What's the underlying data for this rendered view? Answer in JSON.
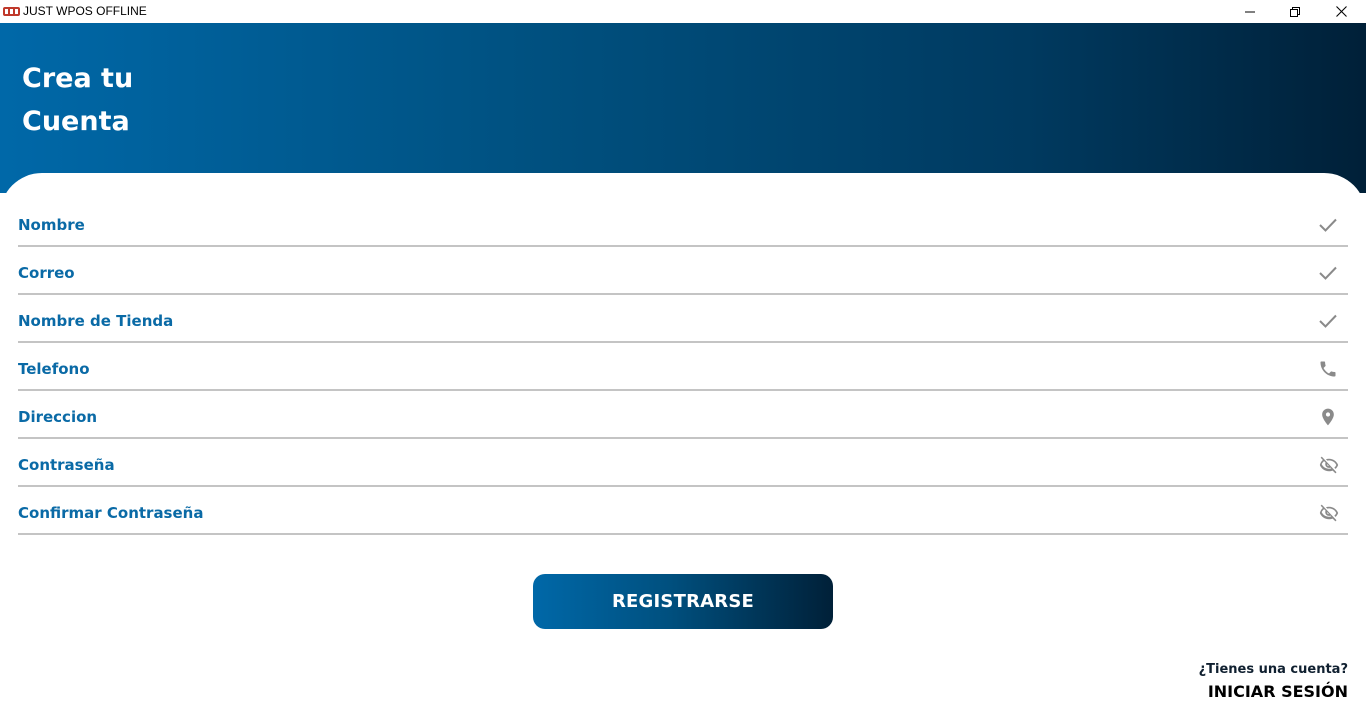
{
  "window": {
    "title": "JUST WPOS OFFLINE",
    "icons": [
      "app-logo-icon",
      "minimize-icon",
      "restore-icon",
      "close-icon"
    ]
  },
  "header": {
    "title_line1": "Crea tu",
    "title_line2": "Cuenta"
  },
  "form": {
    "fields": [
      {
        "label": "Nombre",
        "icon": "check-icon"
      },
      {
        "label": "Correo",
        "icon": "check-icon"
      },
      {
        "label": "Nombre de Tienda",
        "icon": "check-icon"
      },
      {
        "label": "Telefono",
        "icon": "phone-icon"
      },
      {
        "label": "Direccion",
        "icon": "location-pin-icon"
      },
      {
        "label": "Contraseña",
        "icon": "eye-off-icon"
      },
      {
        "label": "Confirmar Contraseña",
        "icon": "eye-off-icon"
      }
    ],
    "submit_label": "REGISTRARSE"
  },
  "footer": {
    "prompt": "¿Tienes una cuenta?",
    "login_label": "INICIAR SESIÓN"
  },
  "colors": {
    "accent": "#0a6aa6",
    "gradient_start": "#0068a8",
    "gradient_end": "#002038",
    "divider": "#c4c4c4",
    "icon_gray": "#8a8a8a"
  }
}
